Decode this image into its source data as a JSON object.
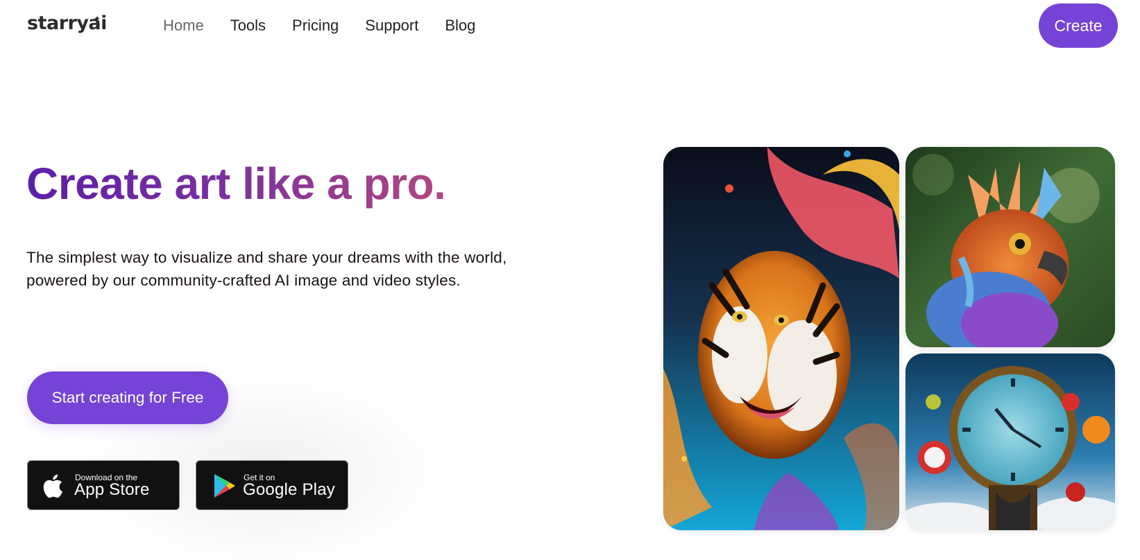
{
  "nav": {
    "logo": "starryai",
    "links": [
      "Home",
      "Tools",
      "Pricing",
      "Support",
      "Blog"
    ],
    "active_link": "Home",
    "create_label": "Create"
  },
  "hero": {
    "title": "Create art like a pro.",
    "subtitle": "The simplest way to visualize and share your dreams with the world, powered by our community-crafted AI image and video styles.",
    "cta_label": "Start creating for Free"
  },
  "stores": {
    "apple": {
      "small": "Download on the",
      "big": "App Store",
      "icon": "apple-icon"
    },
    "google": {
      "small": "Get it on",
      "big": "Google Play",
      "icon": "google-play-icon"
    }
  },
  "gallery": [
    {
      "subject": "tiger",
      "icon": "tiger-artwork-image"
    },
    {
      "subject": "bird",
      "icon": "bird-artwork-image"
    },
    {
      "subject": "clock",
      "icon": "melting-clock-artwork-image"
    }
  ],
  "colors": {
    "accent": "#7543d6",
    "title_gradient_start": "#5a1fa8",
    "title_gradient_end": "#b0487f",
    "store_button_bg": "#111111"
  }
}
